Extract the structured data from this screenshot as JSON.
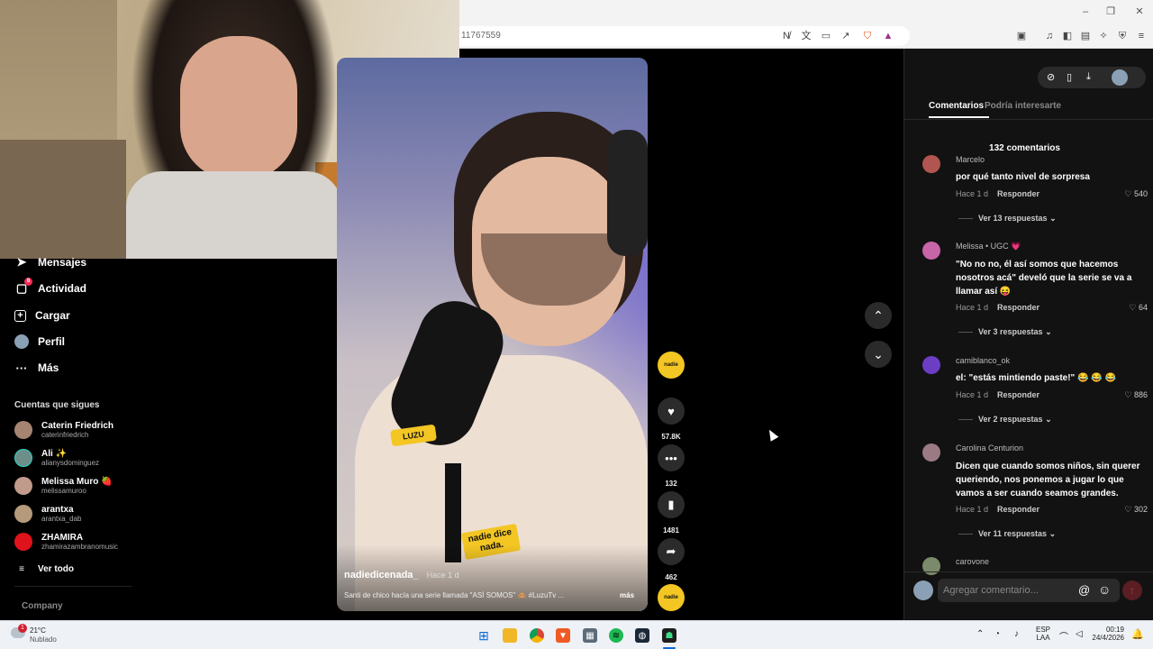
{
  "browser": {
    "url": "11767559",
    "window_controls": [
      "minimize-icon",
      "restore-icon",
      "close-icon"
    ]
  },
  "sidebar": {
    "nav": [
      {
        "label": "Mensajes",
        "icon": "paper-plane-icon",
        "badge": ""
      },
      {
        "label": "Actividad",
        "icon": "message-bubble-icon",
        "badge": "8"
      },
      {
        "label": "Cargar",
        "icon": "plus-square-icon",
        "badge": ""
      },
      {
        "label": "Perfil",
        "icon": "avatar-icon",
        "badge": ""
      },
      {
        "label": "Más",
        "icon": "more-dots-icon",
        "badge": ""
      }
    ],
    "following_title": "Cuentas que sigues",
    "following": [
      {
        "name": "Caterin Friedrich",
        "handle": "caterinfriedrich",
        "color": "#a58572"
      },
      {
        "name": "Ali ✨",
        "handle": "alianysdominguez",
        "color": "#6c8f8a"
      },
      {
        "name": "Melissa Muro 🍓",
        "handle": "melissamuroo",
        "color": "#c09a8a"
      },
      {
        "name": "arantxa",
        "handle": "arantxa_dab",
        "color": "#b59a7c"
      },
      {
        "name": "ZHAMIRA",
        "handle": "zhamirazambranomusic",
        "color": "#e0121b"
      }
    ],
    "see_all": "Ver todo",
    "company": "Company"
  },
  "video": {
    "author": "nadiedicenada_",
    "time": "Hace 1 d",
    "caption": "Santi de chico hacía una serie llamada \"ASÍ SOMOS\" 🙈 #LuzuTv ...",
    "more": "más",
    "overlay_logo": "nadie dice nada.",
    "mic_brand": "LUZU"
  },
  "actions": {
    "likes": "57.8K",
    "comments": "132",
    "saves": "1481",
    "shares": "462"
  },
  "panel": {
    "top_icons": [
      "compass-icon",
      "phone-icon",
      "download-icon",
      "avatar-icon"
    ],
    "tabs": [
      "Comentarios",
      "Podría interesarte"
    ],
    "count": "132 comentarios",
    "comments": [
      {
        "user": "Marcelo",
        "text": "por qué tanto nivel de sorpresa",
        "time": "Hace 1 d",
        "reply": "Responder",
        "likes": "540",
        "replies": "Ver 13 respuestas",
        "color": "#b0554f"
      },
      {
        "user": "Melissa • UGC 💗",
        "text": "\"No no no, él así somos que hacemos nosotros acá\" develó que la serie se va a llamar así 😝",
        "time": "Hace 1 d",
        "reply": "Responder",
        "likes": "64",
        "replies": "Ver 3 respuestas",
        "color": "#c765a8"
      },
      {
        "user": "camiblanco_ok",
        "text": "el: \"estás mintiendo paste!\" 😂 😂 😂",
        "time": "Hace 1 d",
        "reply": "Responder",
        "likes": "886",
        "replies": "Ver 2 respuestas",
        "color": "#6b3ec4"
      },
      {
        "user": "Carolina Centurion",
        "text": "Dicen que cuando somos niños, sin querer queriendo, nos ponemos a jugar lo que vamos a ser cuando seamos grandes.",
        "time": "Hace 1 d",
        "reply": "Responder",
        "likes": "302",
        "replies": "Ver 11 respuestas",
        "color": "#9a7a83"
      },
      {
        "user": "carovone",
        "color": "#7b8a6a"
      }
    ],
    "add_placeholder": "Agregar comentario..."
  },
  "taskbar": {
    "weather_temp": "21°C",
    "weather_desc": "Nublado",
    "weather_badge": "1",
    "lang_top": "ESP",
    "lang_bottom": "LAA",
    "time": "00:19",
    "date": "24/4/2026",
    "apps": [
      "windows-start-icon",
      "file-explorer-icon",
      "chrome-icon",
      "brave-icon",
      "calculator-icon",
      "spotify-icon",
      "steam-icon",
      "android-icon"
    ]
  }
}
